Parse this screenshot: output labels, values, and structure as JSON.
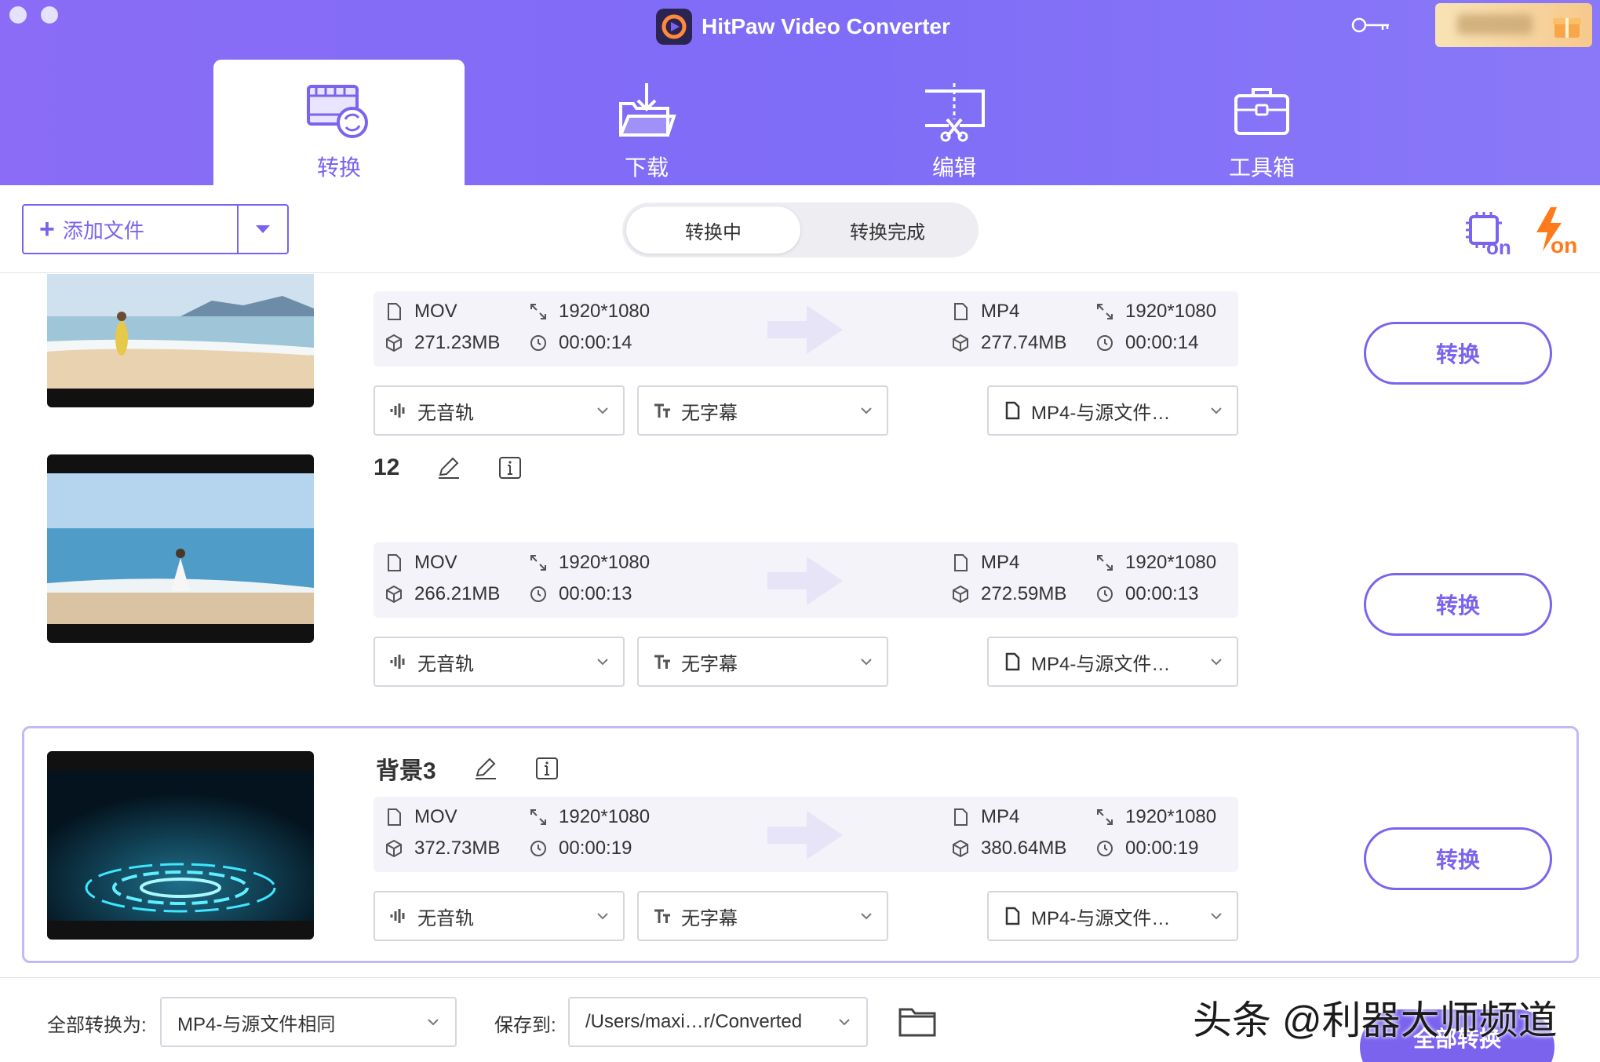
{
  "app": {
    "title": "HitPaw Video Converter"
  },
  "nav": {
    "tabs": [
      {
        "label": "转换"
      },
      {
        "label": "下载"
      },
      {
        "label": "编辑"
      },
      {
        "label": "工具箱"
      }
    ]
  },
  "toolbar": {
    "add_file_label": "添加文件",
    "segments": [
      "转换中",
      "转换完成"
    ],
    "gpu_badge": "on",
    "speed_badge": "on"
  },
  "files": [
    {
      "name": "",
      "src": {
        "format": "MOV",
        "resolution": "1920*1080",
        "size": "271.23MB",
        "duration": "00:00:14"
      },
      "dst": {
        "format": "MP4",
        "resolution": "1920*1080",
        "size": "277.74MB",
        "duration": "00:00:14"
      },
      "audio": "无音轨",
      "subtitle": "无字幕",
      "output": "MP4-与源文件…",
      "convert_label": "转换"
    },
    {
      "name": "12",
      "src": {
        "format": "MOV",
        "resolution": "1920*1080",
        "size": "266.21MB",
        "duration": "00:00:13"
      },
      "dst": {
        "format": "MP4",
        "resolution": "1920*1080",
        "size": "272.59MB",
        "duration": "00:00:13"
      },
      "audio": "无音轨",
      "subtitle": "无字幕",
      "output": "MP4-与源文件…",
      "convert_label": "转换"
    },
    {
      "name": "背景3",
      "src": {
        "format": "MOV",
        "resolution": "1920*1080",
        "size": "372.73MB",
        "duration": "00:00:19"
      },
      "dst": {
        "format": "MP4",
        "resolution": "1920*1080",
        "size": "380.64MB",
        "duration": "00:00:19"
      },
      "audio": "无音轨",
      "subtitle": "无字幕",
      "output": "MP4-与源文件…",
      "convert_label": "转换"
    }
  ],
  "footer": {
    "convert_all_label": "全部转换为:",
    "convert_all_value": "MP4-与源文件相同",
    "save_to_label": "保存到:",
    "save_to_value": "/Users/maxi…r/Converted",
    "convert_all_button": "全部转换"
  },
  "watermark": "头条 @利器大师频道",
  "colors": {
    "accent": "#7b63ee",
    "header": "#8a6cf6",
    "meta_bg": "#f3f3f9"
  }
}
